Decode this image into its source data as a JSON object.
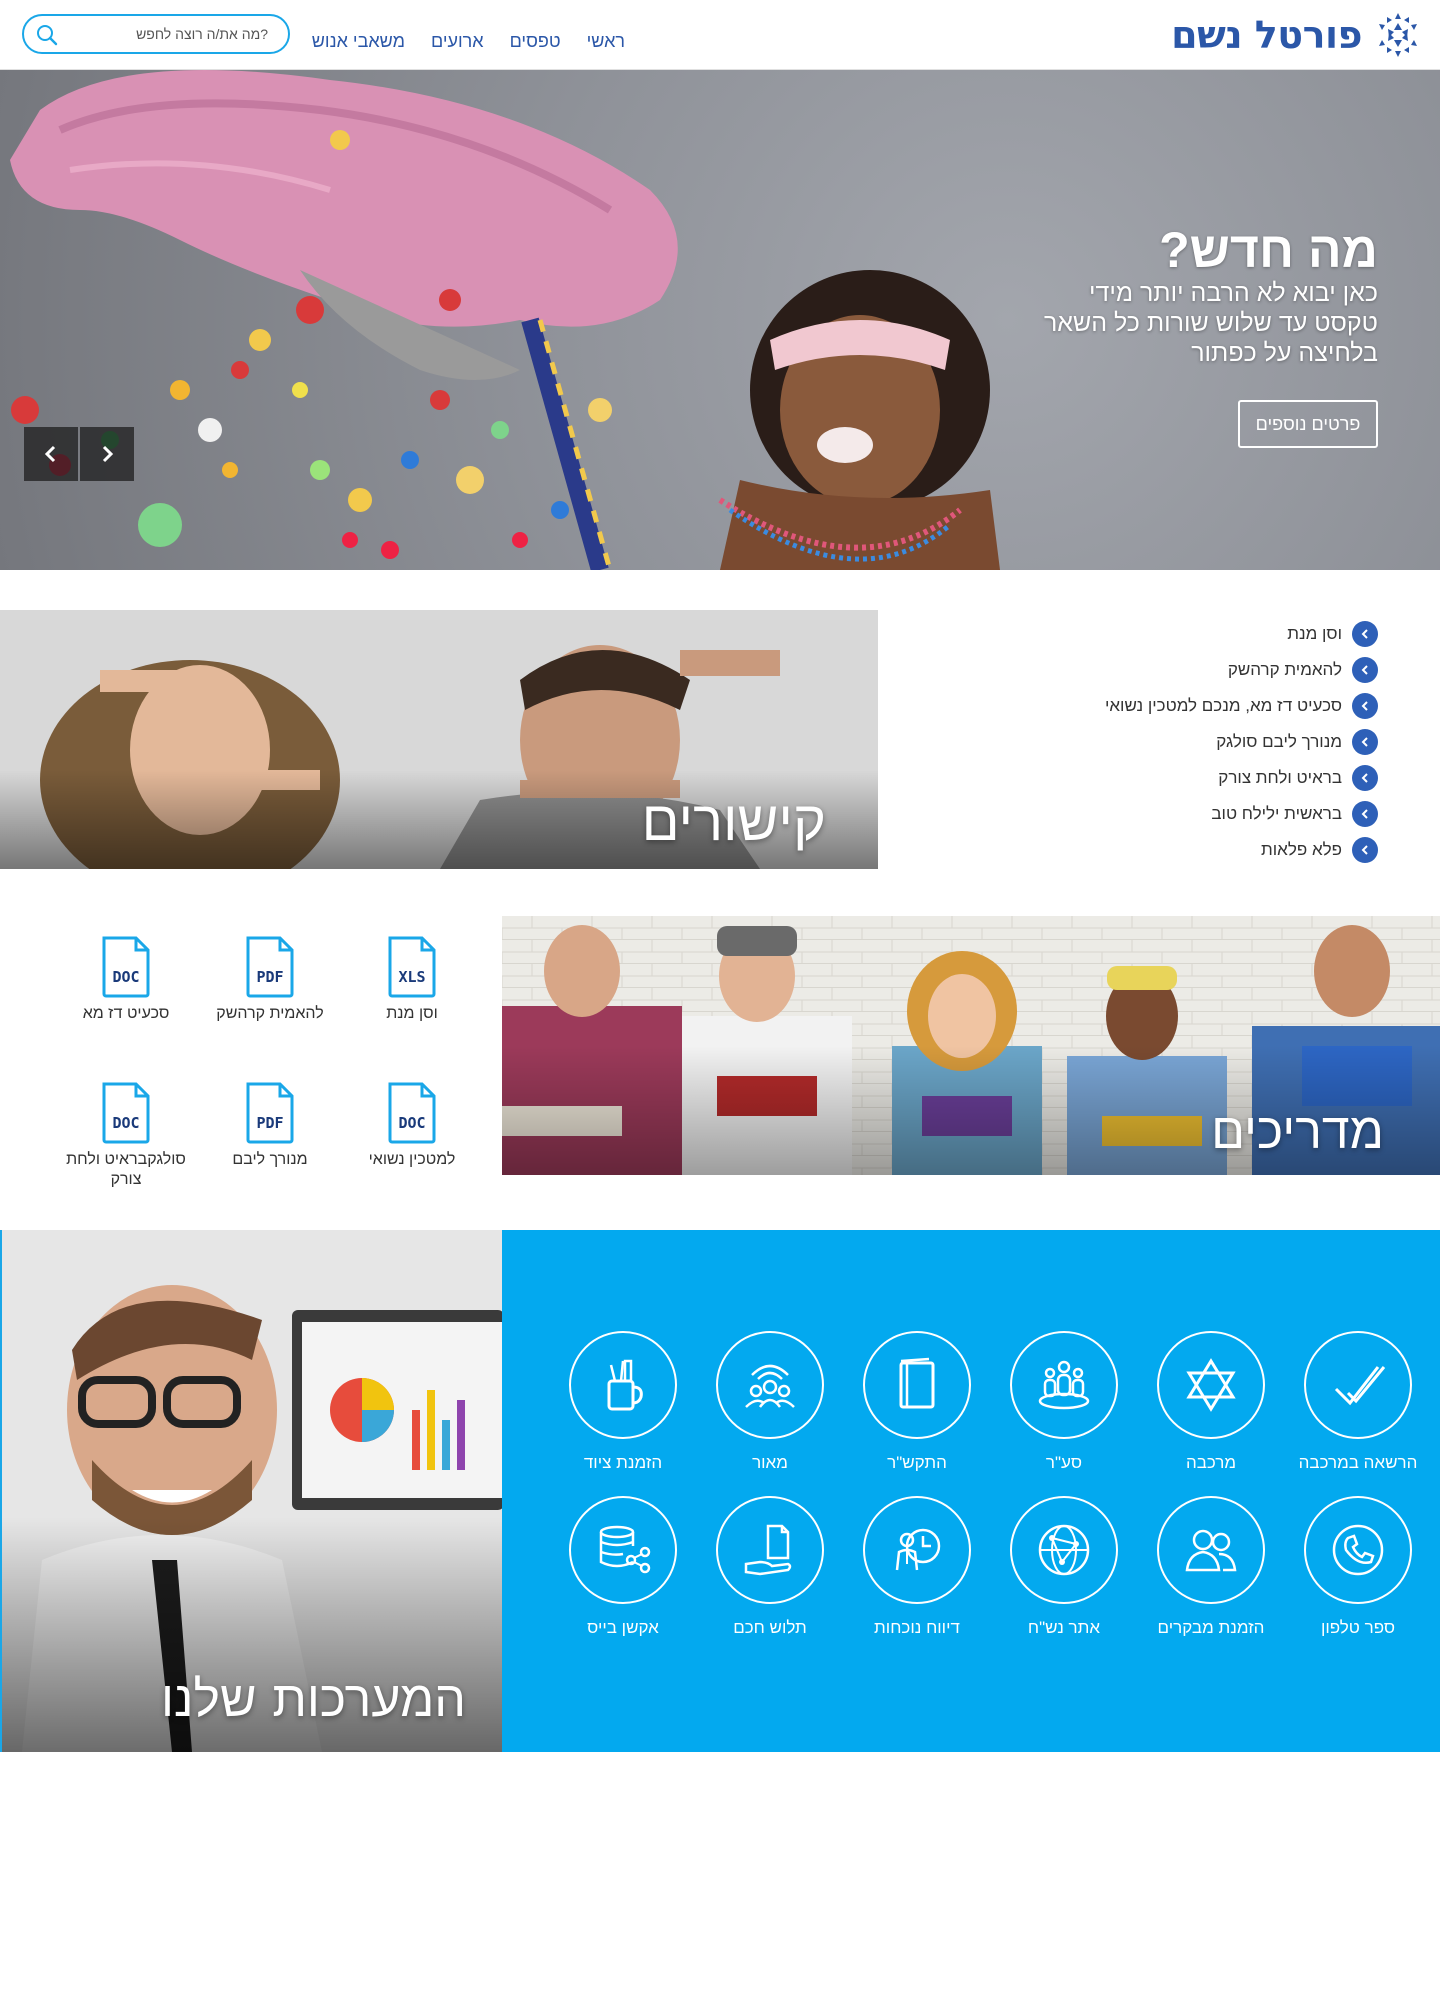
{
  "header": {
    "logo_text": "פורטל נשם",
    "nav": [
      "ראשי",
      "טפסים",
      "ארועים",
      "משאבי אנוש"
    ],
    "search_placeholder": "מה את/ה רוצה לחפש?"
  },
  "hero": {
    "title": "מה חדש?",
    "lines": [
      "כאן יבוא לא הרבה יותר מידי",
      "טקסט עד שלוש שורות כל השאר",
      "בלחיצה על כפתור"
    ],
    "button_label": "פרטים נוספים"
  },
  "links": {
    "title": "קישורים",
    "items": [
      "וסן מנת",
      "להאמית קרהשק",
      "סכעיט דז מא, מנכם למטכין נשואי",
      "מנורך ליבם סולגק",
      "בראיט ולחת צורק",
      "בראשית ילילח טוב",
      "פלא פלאות"
    ]
  },
  "guides": {
    "title": "מדריכים",
    "docs": [
      {
        "type": "XLS",
        "label": "וסן מנת"
      },
      {
        "type": "PDF",
        "label": "להאמית קרהשק"
      },
      {
        "type": "DOC",
        "label": "סכעיט דז מא"
      },
      {
        "type": "DOC",
        "label": "למטכין נשואי"
      },
      {
        "type": "PDF",
        "label": "מנורך ליבם"
      },
      {
        "type": "DOC",
        "label": "סולגקבראיט ולחת צורק"
      }
    ]
  },
  "systems": {
    "title": "המערכות שלנו",
    "items": [
      {
        "label": "הרשאה במרכבה",
        "icon": "double-check-icon"
      },
      {
        "label": "מרכבה",
        "icon": "star-of-david-icon"
      },
      {
        "label": "סע\"ר",
        "icon": "group-icon"
      },
      {
        "label": "התקש\"ר",
        "icon": "book-icon"
      },
      {
        "label": "מאור",
        "icon": "broadcast-group-icon"
      },
      {
        "label": "הזמנת ציוד",
        "icon": "stationery-cup-icon"
      },
      {
        "label": "ספר טלפון",
        "icon": "phone-icon"
      },
      {
        "label": "הזמנת מבקרים",
        "icon": "visitors-icon"
      },
      {
        "label": "אתר נש\"ח",
        "icon": "network-globe-icon"
      },
      {
        "label": "דיווח נוכחות",
        "icon": "attendance-clock-icon"
      },
      {
        "label": "תלוש חכם",
        "icon": "payslip-hand-icon"
      },
      {
        "label": "אקשן בייס",
        "icon": "database-share-icon"
      }
    ]
  },
  "colors": {
    "brand_blue": "#2b57a8",
    "accent_cyan": "#03a9ef",
    "link_bullet": "#2e60b8"
  }
}
